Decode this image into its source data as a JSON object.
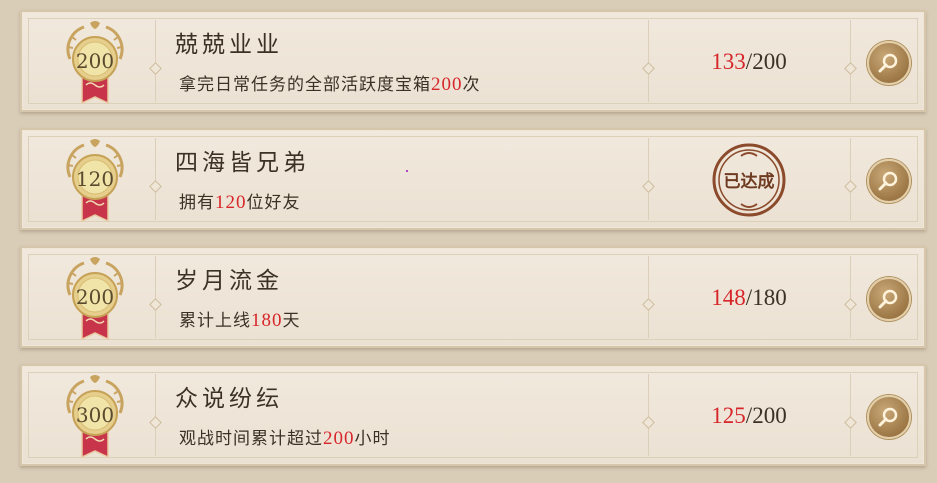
{
  "achievements": [
    {
      "medal": "200",
      "title": "兢兢业业",
      "desc_prefix": "拿完日常任务的全部活跃度宝箱",
      "desc_value": "200",
      "desc_suffix": "次",
      "progress_current": "133",
      "progress_sep": "/",
      "progress_total": "200",
      "completed": false
    },
    {
      "medal": "120",
      "title": "四海皆兄弟",
      "desc_prefix": "拥有",
      "desc_value": "120",
      "desc_suffix": "位好友",
      "completed": true,
      "stamp_text": "已达成"
    },
    {
      "medal": "200",
      "title": "岁月流金",
      "desc_prefix": "累计上线",
      "desc_value": "180",
      "desc_suffix": "天",
      "progress_current": "148",
      "progress_sep": "/",
      "progress_total": "180",
      "completed": false
    },
    {
      "medal": "300",
      "title": "众说纷纭",
      "desc_prefix": "观战时间累计超过",
      "desc_value": "200",
      "desc_suffix": "小时",
      "progress_current": "125",
      "progress_sep": "/",
      "progress_total": "200",
      "completed": false
    }
  ],
  "colors": {
    "highlight": "#d7262a",
    "text": "#3b3125",
    "stamp": "#8b4a2b"
  },
  "icons": {
    "medal": "laurel-medal-icon",
    "search": "magnifier-icon",
    "stamp": "completed-seal-icon"
  }
}
